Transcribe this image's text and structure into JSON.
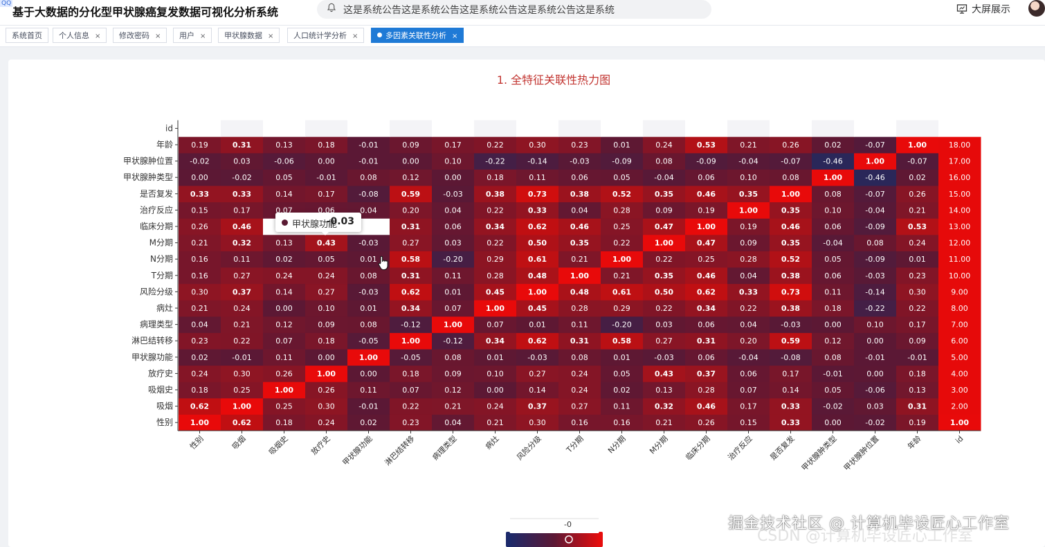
{
  "app": {
    "title": "基于大数据的分化型甲状腺癌复发数据可视化分析系统",
    "corner_tag": "QQ",
    "notice": "这是系统公告这是系统公告这是系统公告这是系统公告这是系统",
    "big_screen": "大屏展示"
  },
  "tabs": [
    {
      "label": "系统首页",
      "closable": false,
      "active": false
    },
    {
      "label": "个人信息",
      "closable": true,
      "active": false
    },
    {
      "label": "修改密码",
      "closable": true,
      "active": false
    },
    {
      "label": "用户",
      "closable": true,
      "active": false
    },
    {
      "label": "甲状腺数据",
      "closable": true,
      "active": false
    },
    {
      "label": "人口统计学分析",
      "closable": true,
      "active": false
    },
    {
      "label": "多因素关联性分析",
      "closable": true,
      "active": true
    }
  ],
  "close_glyph": "×",
  "tooltip": {
    "name": "甲状腺功能",
    "value": "-0.03"
  },
  "visual_map": {
    "label": "-0",
    "min_color": "#1c2a6b",
    "max_color": "#e60d0d"
  },
  "watermark": {
    "line1": "掘金技术社区 @ 计算机毕设匠心工作室",
    "line2": "CSDN @计算机毕设匠心工作室"
  },
  "colors": {
    "accent": "#1f7ad6",
    "title_red": "#c23531"
  },
  "chart_data": {
    "type": "heatmap",
    "title": "1. 全特征关联性热力图",
    "x_categories": [
      "性别",
      "吸烟",
      "吸烟史",
      "放疗史",
      "甲状腺功能",
      "淋巴结转移",
      "病理类型",
      "病灶",
      "风险分级",
      "T分期",
      "N分期",
      "M分期",
      "临床分期",
      "治疗反应",
      "是否复发",
      "甲状腺肿类型",
      "甲状腺肿位置",
      "年龄",
      "id"
    ],
    "y_categories": [
      "性别",
      "吸烟",
      "吸烟史",
      "放疗史",
      "甲状腺功能",
      "淋巴结转移",
      "病理类型",
      "病灶",
      "风险分级",
      "T分期",
      "N分期",
      "M分期",
      "临床分期",
      "治疗反应",
      "是否复发",
      "甲状腺肿类型",
      "甲状腺肿位置",
      "年龄",
      "id"
    ],
    "rows": [
      [
        "1.00",
        "0.62",
        "0.18",
        "0.24",
        "0.02",
        "0.23",
        "0.04",
        "0.21",
        "0.30",
        "0.16",
        "0.16",
        "0.21",
        "0.26",
        "0.15",
        "0.33",
        "0.00",
        "-0.02",
        "0.19",
        "1.00"
      ],
      [
        "0.62",
        "1.00",
        "0.25",
        "0.30",
        "-0.01",
        "0.22",
        "0.21",
        "0.24",
        "0.37",
        "0.27",
        "0.11",
        "0.32",
        "0.46",
        "0.17",
        "0.33",
        "-0.02",
        "0.03",
        "0.31",
        "2.00"
      ],
      [
        "0.18",
        "0.25",
        "1.00",
        "0.26",
        "0.11",
        "0.07",
        "0.12",
        "0.00",
        "0.14",
        "0.24",
        "0.02",
        "0.13",
        "0.28",
        "0.07",
        "0.14",
        "0.05",
        "-0.06",
        "0.13",
        "3.00"
      ],
      [
        "0.24",
        "0.30",
        "0.26",
        "1.00",
        "0.00",
        "0.18",
        "0.09",
        "0.10",
        "0.27",
        "0.24",
        "0.05",
        "0.43",
        "0.37",
        "0.06",
        "0.17",
        "-0.01",
        "0.00",
        "0.18",
        "4.00"
      ],
      [
        "0.02",
        "-0.01",
        "0.11",
        "0.00",
        "1.00",
        "-0.05",
        "0.08",
        "0.01",
        "-0.03",
        "0.08",
        "0.01",
        "-0.03",
        "0.06",
        "-0.04",
        "-0.08",
        "0.08",
        "-0.01",
        "-0.01",
        "5.00"
      ],
      [
        "0.23",
        "0.22",
        "0.07",
        "0.18",
        "-0.05",
        "1.00",
        "-0.12",
        "0.34",
        "0.62",
        "0.31",
        "0.58",
        "0.27",
        "0.31",
        "0.20",
        "0.59",
        "0.12",
        "0.00",
        "0.09",
        "6.00"
      ],
      [
        "0.04",
        "0.21",
        "0.12",
        "0.09",
        "0.08",
        "-0.12",
        "1.00",
        "0.07",
        "0.01",
        "0.11",
        "-0.20",
        "0.03",
        "0.06",
        "0.04",
        "-0.03",
        "0.00",
        "0.10",
        "0.17",
        "7.00"
      ],
      [
        "0.21",
        "0.24",
        "0.00",
        "0.10",
        "0.01",
        "0.34",
        "0.07",
        "1.00",
        "0.45",
        "0.28",
        "0.29",
        "0.22",
        "0.34",
        "0.22",
        "0.38",
        "0.18",
        "-0.22",
        "0.22",
        "8.00"
      ],
      [
        "0.30",
        "0.37",
        "0.14",
        "0.27",
        "-0.03",
        "0.62",
        "0.01",
        "0.45",
        "1.00",
        "0.48",
        "0.61",
        "0.50",
        "0.62",
        "0.33",
        "0.73",
        "0.11",
        "-0.14",
        "0.30",
        "9.00"
      ],
      [
        "0.16",
        "0.27",
        "0.24",
        "0.24",
        "0.08",
        "0.31",
        "0.11",
        "0.28",
        "0.48",
        "1.00",
        "0.21",
        "0.35",
        "0.46",
        "0.04",
        "0.38",
        "0.06",
        "-0.03",
        "0.23",
        "10.00"
      ],
      [
        "0.16",
        "0.11",
        "0.02",
        "0.05",
        "0.01",
        "0.58",
        "-0.20",
        "0.29",
        "0.61",
        "0.21",
        "1.00",
        "0.22",
        "0.25",
        "0.28",
        "0.52",
        "0.05",
        "-0.09",
        "0.01",
        "11.00"
      ],
      [
        "0.21",
        "0.32",
        "0.13",
        "0.43",
        "-0.03",
        "0.27",
        "0.03",
        "0.22",
        "0.50",
        "0.35",
        "0.22",
        "1.00",
        "0.47",
        "0.09",
        "0.35",
        "-0.04",
        "0.08",
        "0.24",
        "12.00"
      ],
      [
        "0.26",
        "0.46",
        "",
        "",
        "",
        "0.31",
        "0.06",
        "0.34",
        "0.62",
        "0.46",
        "0.25",
        "0.47",
        "1.00",
        "0.19",
        "0.46",
        "0.06",
        "-0.09",
        "0.53",
        "13.00"
      ],
      [
        "0.15",
        "0.17",
        "0.07",
        "0.06",
        "0.04",
        "0.20",
        "0.04",
        "0.22",
        "0.33",
        "0.04",
        "0.28",
        "0.09",
        "0.19",
        "1.00",
        "0.35",
        "0.10",
        "-0.04",
        "0.21",
        "14.00"
      ],
      [
        "0.33",
        "0.33",
        "0.14",
        "0.17",
        "-0.08",
        "0.59",
        "-0.03",
        "0.38",
        "0.73",
        "0.38",
        "0.52",
        "0.35",
        "0.46",
        "0.35",
        "1.00",
        "0.08",
        "-0.07",
        "0.26",
        "15.00"
      ],
      [
        "0.00",
        "-0.02",
        "0.05",
        "-0.01",
        "0.08",
        "0.12",
        "0.00",
        "0.18",
        "0.11",
        "0.06",
        "0.05",
        "-0.04",
        "0.06",
        "0.10",
        "0.08",
        "1.00",
        "-0.46",
        "0.02",
        "16.00"
      ],
      [
        "-0.02",
        "0.03",
        "-0.06",
        "0.00",
        "-0.01",
        "0.00",
        "0.10",
        "-0.22",
        "-0.14",
        "-0.03",
        "-0.09",
        "0.08",
        "-0.09",
        "-0.04",
        "-0.07",
        "-0.46",
        "1.00",
        "-0.07",
        "17.00"
      ],
      [
        "0.19",
        "0.31",
        "0.13",
        "0.18",
        "-0.01",
        "0.09",
        "0.17",
        "0.22",
        "0.30",
        "0.23",
        "0.01",
        "0.24",
        "0.53",
        "0.21",
        "0.26",
        "0.02",
        "-0.07",
        "1.00",
        "18.00"
      ],
      [
        "",
        "",
        "",
        "",
        "",
        "",
        "",
        "",
        "",
        "",
        "",
        "",
        "",
        "",
        "",
        "",
        "",
        "",
        ""
      ]
    ],
    "extra_y_label": "id"
  }
}
